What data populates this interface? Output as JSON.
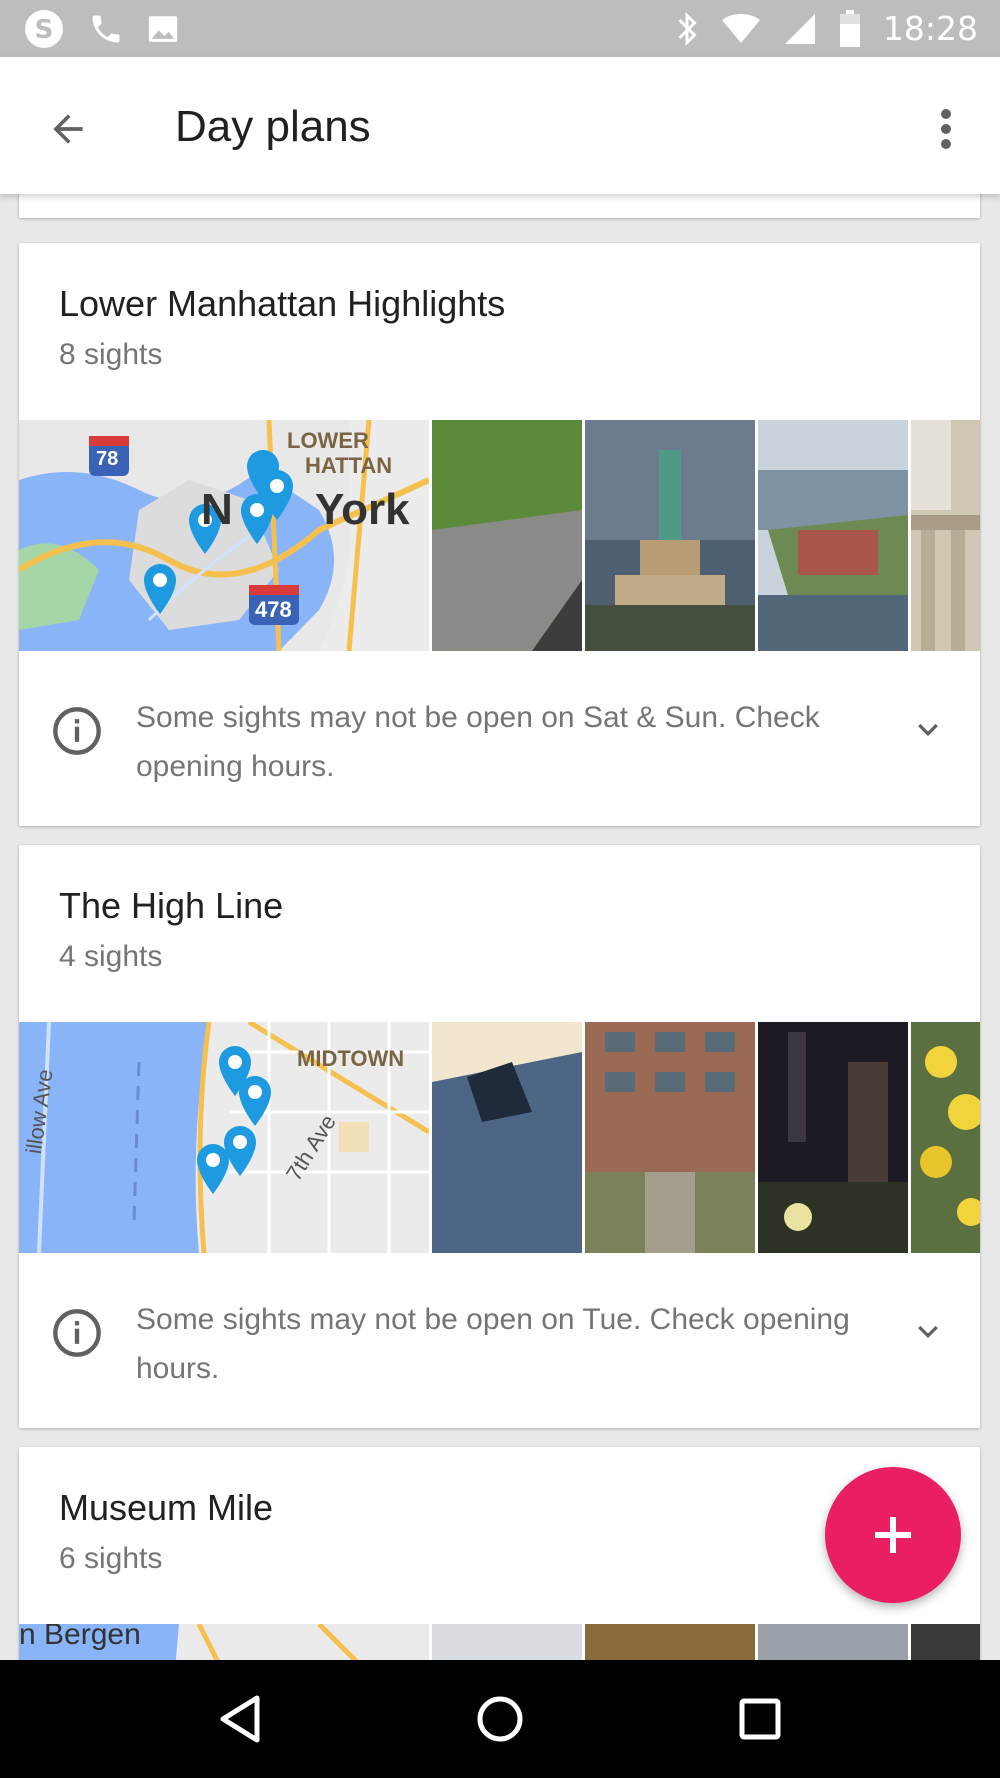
{
  "status_bar": {
    "time": "18:28",
    "left_icons": [
      "skype-icon",
      "phone-icon",
      "image-icon"
    ],
    "right_icons": [
      "bluetooth-icon",
      "wifi-icon",
      "signal-icon",
      "battery-icon"
    ]
  },
  "app_bar": {
    "title": "Day plans",
    "back_icon": "arrow-back-icon",
    "menu_icon": "more-vert-icon"
  },
  "plans": [
    {
      "title": "Lower Manhattan Highlights",
      "sights": "8 sights",
      "map_labels": [
        "LOWER",
        "HATTAN",
        "N",
        "York",
        "78",
        "478"
      ],
      "info": "Some sights may not be open on Sat & Sun. Check opening hours."
    },
    {
      "title": "The High Line",
      "sights": "4 sights",
      "map_labels": [
        "MIDTOWN",
        "7th Ave",
        "illow Ave"
      ],
      "info": "Some sights may not be open on Tue. Check opening hours."
    },
    {
      "title": "Museum Mile",
      "sights": "6 sights",
      "map_labels": [
        "n Bergen"
      ]
    }
  ],
  "fab": {
    "icon": "plus-icon"
  },
  "colors": {
    "accent": "#e91e63",
    "map_water": "#8ab4f8",
    "marker": "#1e9be0"
  }
}
